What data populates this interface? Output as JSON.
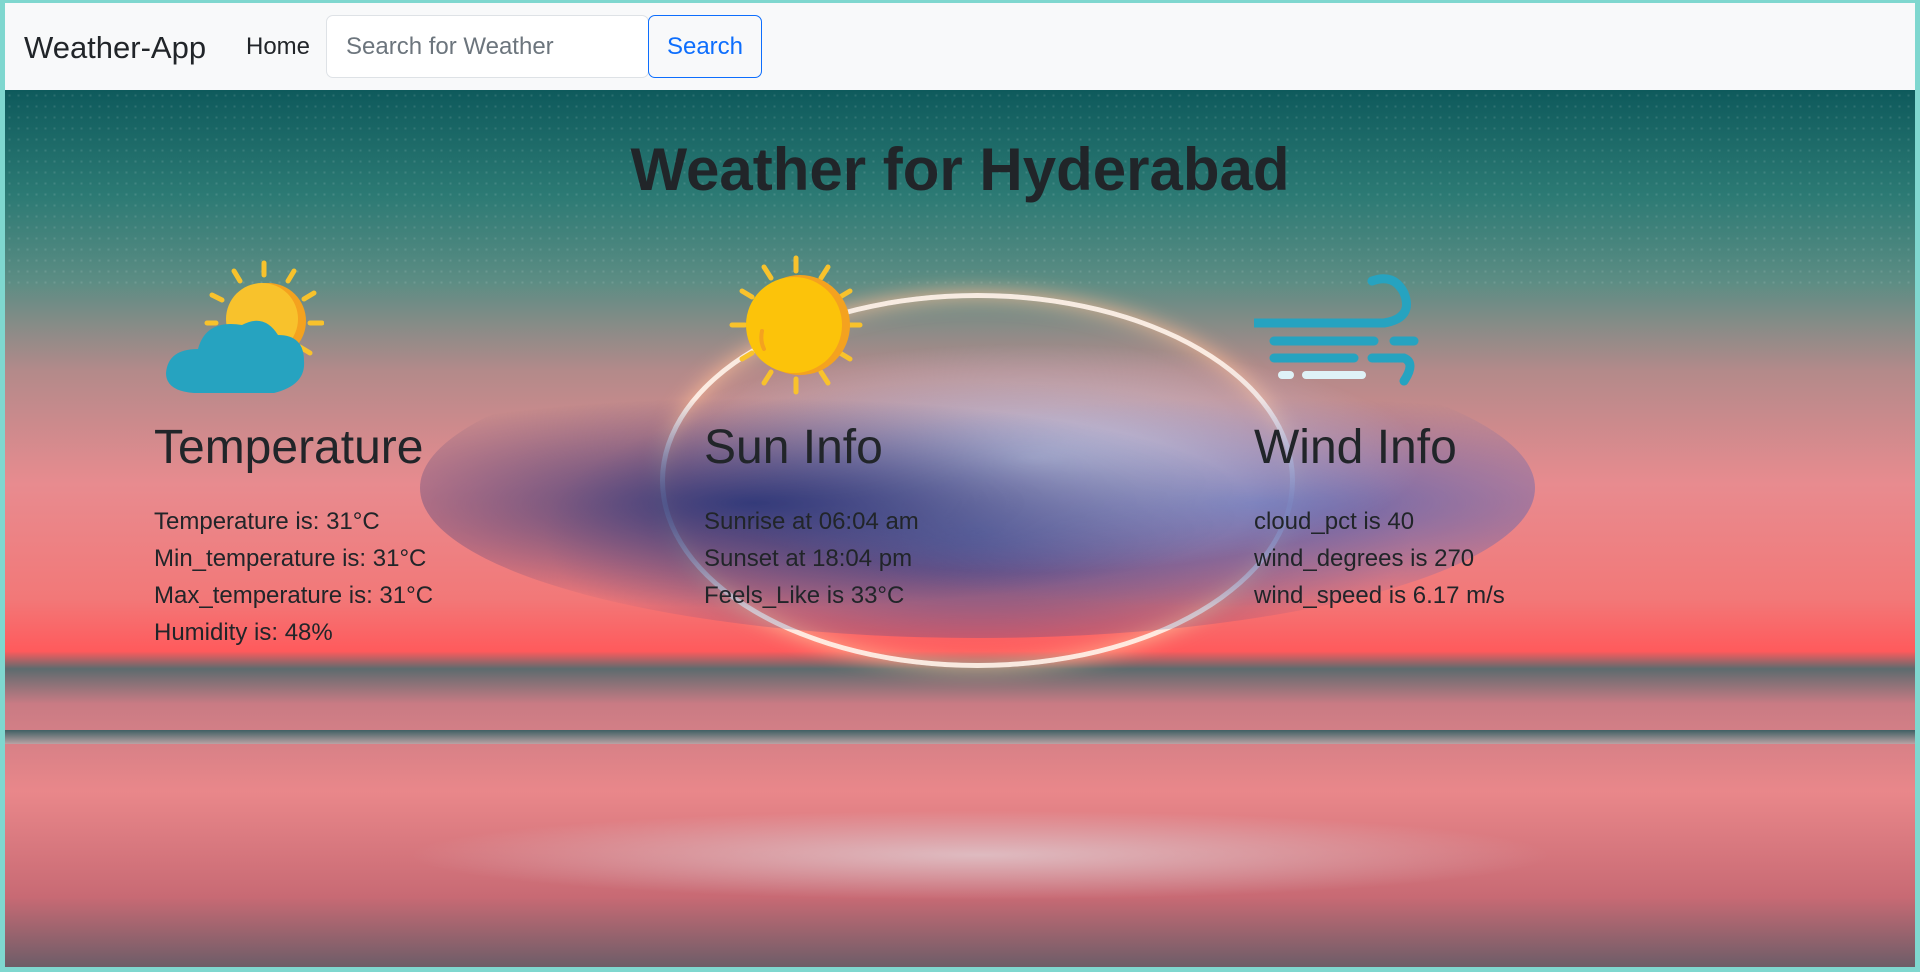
{
  "navbar": {
    "brand": "Weather-App",
    "home_label": "Home",
    "search_placeholder": "Search for Weather",
    "search_button": "Search"
  },
  "main": {
    "title": "Weather for Hyderabad",
    "temperature_card": {
      "heading": "Temperature",
      "icon": "sun-behind-cloud-icon",
      "lines": [
        "Temperature is: 31°C",
        "Min_temperature is: 31°C",
        "Max_temperature is: 31°C",
        "Humidity is: 48%"
      ]
    },
    "sun_card": {
      "heading": "Sun Info",
      "icon": "sun-icon",
      "lines": [
        "Sunrise at 06:04 am",
        "Sunset at 18:04 pm",
        "Feels_Like is 33°C"
      ]
    },
    "wind_card": {
      "heading": "Wind Info",
      "icon": "wind-icon",
      "lines": [
        "cloud_pct is 40",
        "wind_degrees is 270",
        "wind_speed is 6.17 m/s"
      ]
    }
  },
  "colors": {
    "primary": "#0d6efd",
    "sun_yellow": "#f8c22c",
    "cloud_teal": "#26a3c0"
  }
}
